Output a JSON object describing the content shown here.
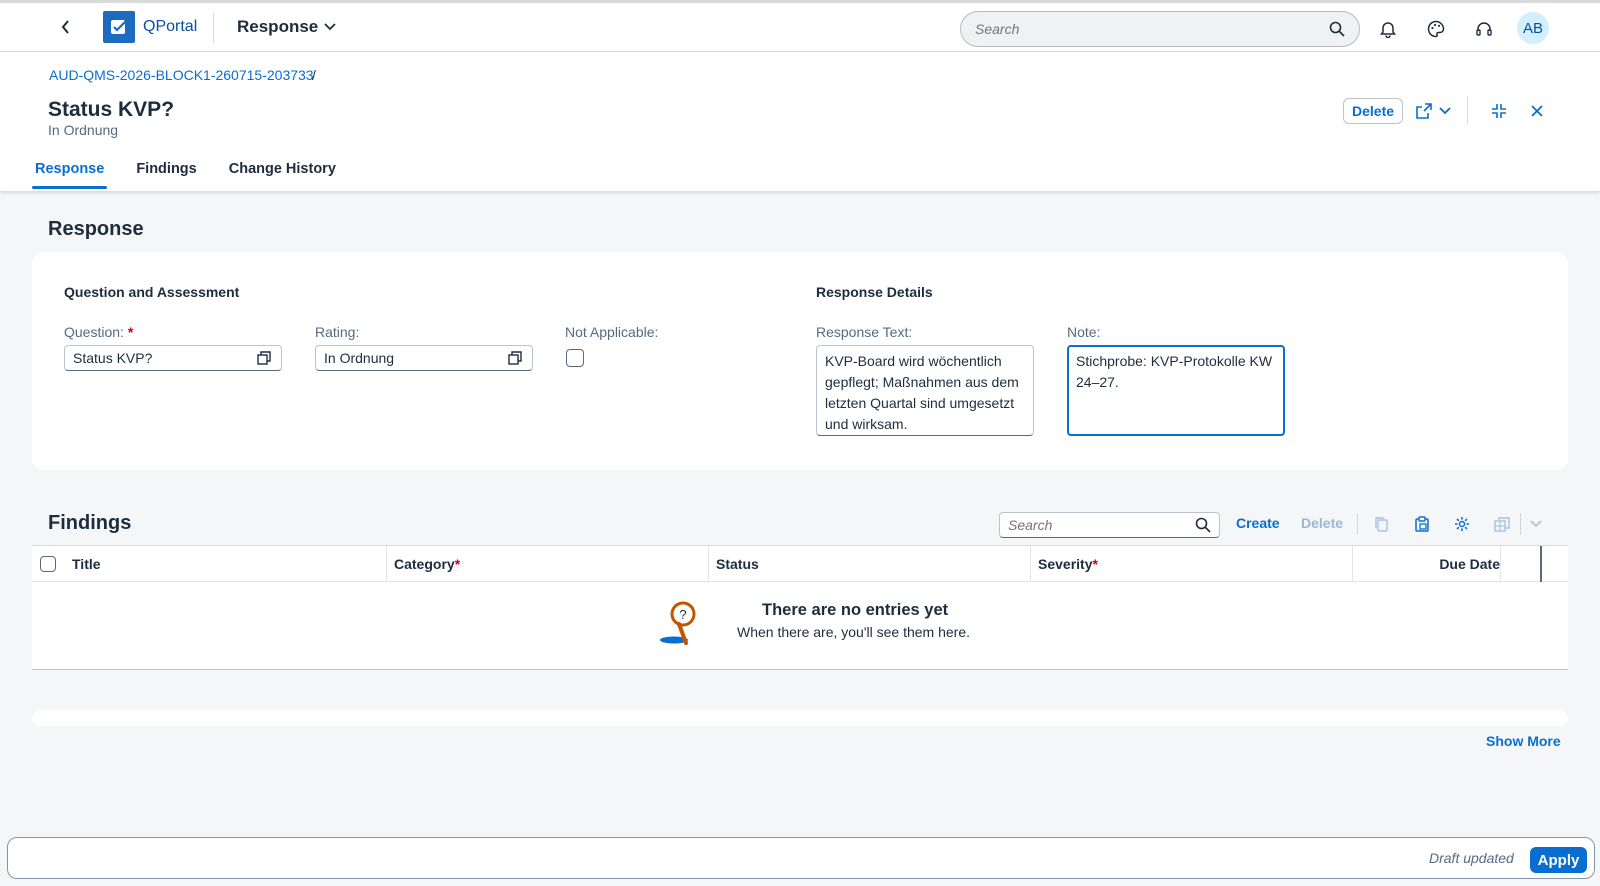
{
  "shell": {
    "product": "QPortal",
    "app_title": "Response",
    "search_placeholder": "Search",
    "avatar_initials": "AB"
  },
  "header": {
    "breadcrumb": "AUD-QMS-2026-BLOCK1-260715-203733",
    "breadcrumb_sep": "/",
    "title": "Status KVP?",
    "subtitle": "In Ordnung",
    "delete_label": "Delete",
    "tabs": [
      {
        "label": "Response",
        "active": true
      },
      {
        "label": "Findings",
        "active": false
      },
      {
        "label": "Change History",
        "active": false
      }
    ]
  },
  "response": {
    "section_title": "Response",
    "group_left": "Question and Assessment",
    "group_right": "Response Details",
    "question_label": "Question:",
    "question_required": "*",
    "question_value": "Status KVP?",
    "rating_label": "Rating:",
    "rating_value": "In Ordnung",
    "na_label": "Not Applicable:",
    "na_checked": false,
    "response_text_label": "Response Text:",
    "response_text_value": "KVP-Board wird wöchentlich gepflegt; Maßnahmen aus dem letzten Quartal sind umgesetzt und wirksam.",
    "note_label": "Note:",
    "note_value": "Stichprobe: KVP-Protokolle KW 24–27."
  },
  "findings": {
    "section_title": "Findings",
    "search_placeholder": "Search",
    "create_label": "Create",
    "delete_label": "Delete",
    "columns": [
      {
        "label": "Title",
        "required": false
      },
      {
        "label": "Category",
        "required": true
      },
      {
        "label": "Status",
        "required": false
      },
      {
        "label": "Severity",
        "required": true
      },
      {
        "label": "Due Date",
        "required": false
      }
    ],
    "required_mark": "*",
    "empty_title": "There are no entries yet",
    "empty_text": "When there are, you'll see them here.",
    "show_more": "Show More"
  },
  "footer": {
    "draft_status": "Draft updated",
    "apply_label": "Apply"
  },
  "colors": {
    "accent": "#0a6ed1",
    "brand": "#1c6bbd",
    "required": "#c4001a",
    "background": "#f5f6f7"
  }
}
